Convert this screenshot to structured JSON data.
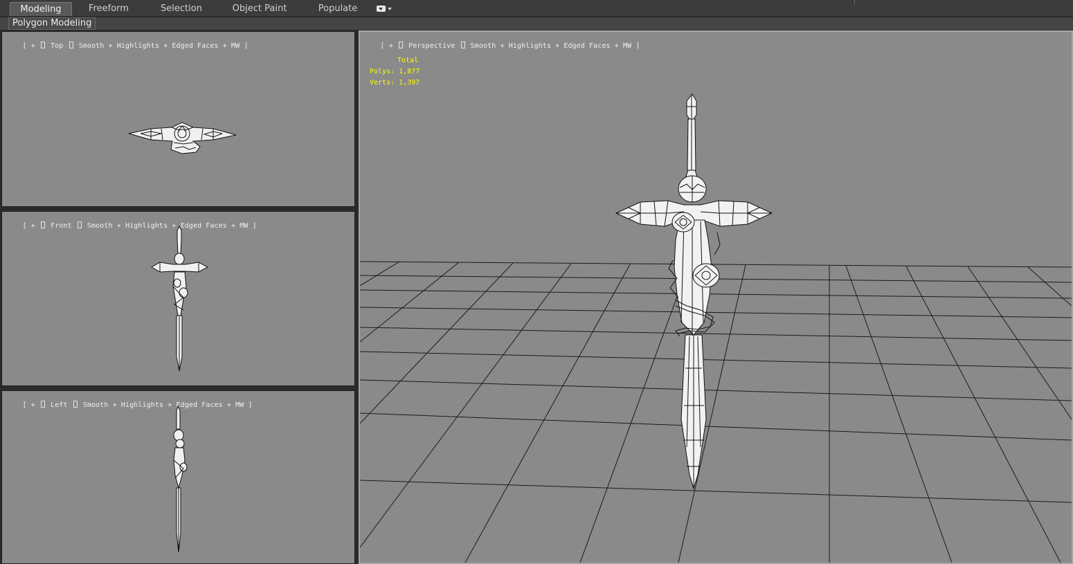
{
  "ribbon": {
    "tabs": [
      {
        "label": "Modeling",
        "active": true
      },
      {
        "label": "Freeform",
        "active": false
      },
      {
        "label": "Selection",
        "active": false
      },
      {
        "label": "Object Paint",
        "active": false
      },
      {
        "label": "Populate",
        "active": false
      }
    ],
    "panel_label": "Polygon Modeling",
    "toggle_icon": "ribbon-minimize-icon"
  },
  "viewports": {
    "top": {
      "label_prefix": "[ + ]",
      "name": "Top",
      "mode": "Smooth + Highlights + Edged Faces + MW ]"
    },
    "front": {
      "label_prefix": "[ + ]",
      "name": "Front",
      "mode": "Smooth + Highlights + Edged Faces + MW ]"
    },
    "left": {
      "label_prefix": "[ + ]",
      "name": "Left",
      "mode": "Smooth + Highlights + Edged Faces + MW ]"
    },
    "perspective": {
      "label_prefix": "[ + ]",
      "name": "Perspective",
      "mode": "Smooth + Highlights + Edged Faces + MW ]"
    }
  },
  "stats": {
    "total_label": "Total",
    "polys_label": "Polys:",
    "polys_value": "1,877",
    "verts_label": "Verts:",
    "verts_value": "1,397"
  },
  "colors": {
    "viewport_bg": "#8a8a8a",
    "stats_text": "#ffff00",
    "grid_line": "#1a1a1a",
    "model_fill": "#f2f2f2",
    "model_wire": "#111111"
  }
}
